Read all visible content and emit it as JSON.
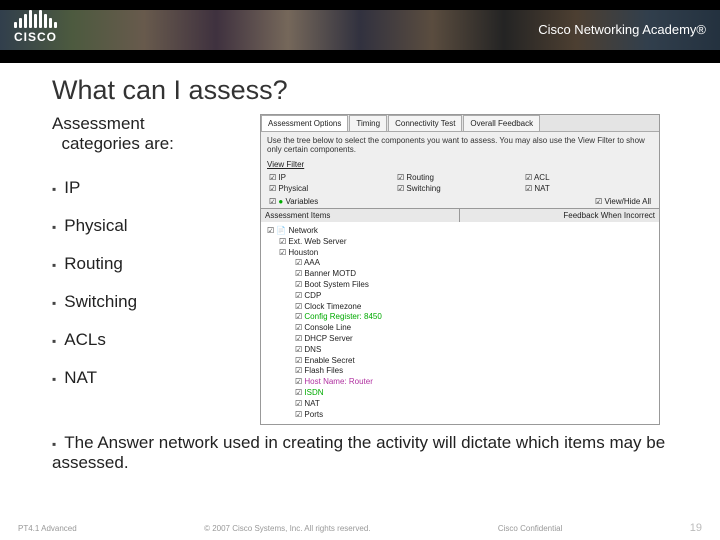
{
  "header": {
    "brand": "CISCO",
    "academy": "Cisco Networking Academy®"
  },
  "slide": {
    "title": "What can I assess?",
    "intro_l1": "Assessment",
    "intro_l2": "categories are:",
    "bullets": [
      "IP",
      "Physical",
      "Routing",
      "Switching",
      "ACLs",
      "NAT"
    ],
    "final": "The Answer network used in creating the activity will dictate which items may be assessed."
  },
  "panel": {
    "tabs": [
      "Assessment Options",
      "Timing",
      "Connectivity Test",
      "Overall Feedback"
    ],
    "hint": "Use the tree below to select the components you want to assess. You may also use the View Filter to show only certain components.",
    "view_filter": "View Filter",
    "checks_row1": [
      "IP",
      "Routing",
      "ACL"
    ],
    "checks_row2": [
      "Physical",
      "Switching",
      "NAT"
    ],
    "variables": "Variables",
    "view_all": "View/Hide All",
    "split_l": "Assessment Items",
    "split_r": "Feedback When Incorrect",
    "tree": {
      "root": "Network",
      "l1a": "Ext. Web Server",
      "l1b": "Houston",
      "children": [
        {
          "t": "AAA"
        },
        {
          "t": "Banner MOTD"
        },
        {
          "t": "Boot System Files"
        },
        {
          "t": "CDP"
        },
        {
          "t": "Clock Timezone"
        },
        {
          "t": "Config Register: 8450",
          "cls": "green"
        },
        {
          "t": "Console Line"
        },
        {
          "t": "DHCP Server"
        },
        {
          "t": "DNS"
        },
        {
          "t": "Enable Secret"
        },
        {
          "t": "Flash Files"
        },
        {
          "t": "Host Name: Router",
          "cls": "mag"
        },
        {
          "t": "ISDN",
          "cls": "green"
        },
        {
          "t": "NAT"
        },
        {
          "t": "Ports"
        }
      ]
    }
  },
  "footer": {
    "left": "PT4.1 Advanced",
    "center": "© 2007 Cisco Systems, Inc. All rights reserved.",
    "right": "Cisco Confidential",
    "page": "19"
  }
}
